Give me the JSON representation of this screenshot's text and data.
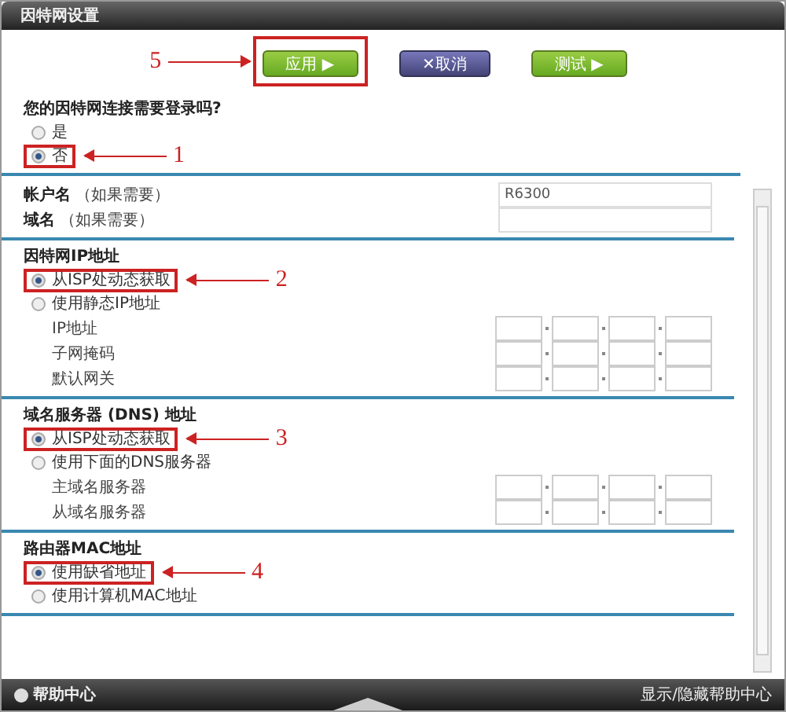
{
  "window": {
    "title": "因特网设置"
  },
  "buttons": [
    {
      "kind": "apply",
      "label": "应用 ▶",
      "callout": "5"
    },
    {
      "kind": "cancel",
      "label": "✕取消"
    },
    {
      "kind": "test",
      "label": "测试 ▶"
    }
  ],
  "login_question": {
    "label": "您的因特网连接需要登录吗?",
    "options": [
      {
        "label": "是",
        "selected": false
      },
      {
        "label": "否",
        "selected": true,
        "callout": "1"
      }
    ]
  },
  "account": [
    {
      "label": "帐户名",
      "hint": "（如果需要）",
      "value": "R6300"
    },
    {
      "label": "域名",
      "hint": "（如果需要）"
    }
  ],
  "sections": [
    {
      "title": "因特网IP地址",
      "options": [
        {
          "label": "从ISP处动态获取",
          "selected": true,
          "callout": "2"
        },
        {
          "label": "使用静态IP地址",
          "selected": false
        }
      ],
      "address_rows": [
        "IP地址",
        "子网掩码",
        "默认网关"
      ]
    },
    {
      "title": "域名服务器 (DNS) 地址",
      "options": [
        {
          "label": "从ISP处动态获取",
          "selected": true,
          "callout": "3"
        },
        {
          "label": "使用下面的DNS服务器",
          "selected": false
        }
      ],
      "address_rows": [
        "主域名服务器",
        "从域名服务器"
      ]
    },
    {
      "title": "路由器MAC地址",
      "options": [
        {
          "label": "使用缺省地址",
          "selected": true,
          "callout": "4"
        },
        {
          "label": "使用计算机MAC地址",
          "selected": false
        }
      ]
    }
  ],
  "footer": {
    "help": "帮助中心",
    "toggle": "显示/隐藏帮助中心"
  }
}
